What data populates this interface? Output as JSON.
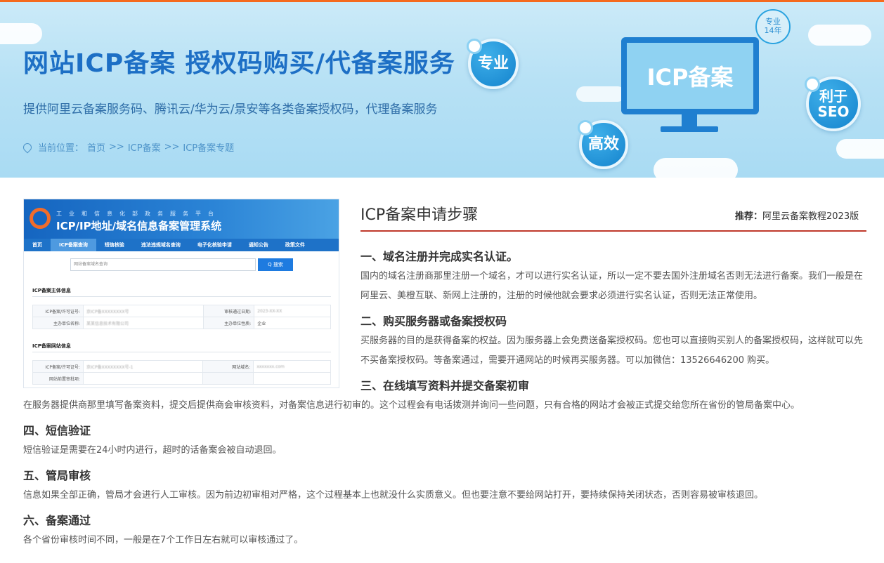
{
  "banner": {
    "title": "网站ICP备案 授权码购买/代备案服务",
    "subtitle": "提供阿里云备案服务码、腾讯云/华为云/景安等各类备案授权码，代理备案服务",
    "breadcrumb_prefix": "当前位置：",
    "breadcrumb": [
      "首页",
      "ICP备案",
      "ICP备案专题"
    ],
    "breadcrumb_sep": ">>",
    "badge_top": "专业",
    "badge_bottom": "14年",
    "bubbles": {
      "pro": "专业",
      "efficient": "高效",
      "seo_line1": "利于",
      "seo_line2": "SEO"
    },
    "monitor_text": "ICP备案"
  },
  "screenshot": {
    "top_small": "工业和信息化部政务服务平台",
    "title": "ICP/IP地址/域名信息备案管理系统",
    "nav": [
      "首页",
      "ICP备案查询",
      "短信核验",
      "违法违规域名查询",
      "电子化核验申请",
      "通知公告",
      "政策文件"
    ],
    "search_placeholder": "网站备案域名查询",
    "search_button": "Q 搜索",
    "section1": "ICP备案主体信息",
    "section2": "ICP备案网站信息",
    "rows1": [
      {
        "k1": "ICP备案/许可证号:",
        "v1": "京ICP备XXXXXXXX号",
        "k2": "审核通过日期:",
        "v2": "2023-XX-XX"
      },
      {
        "k1": "主办单位名称:",
        "v1": "某某信息技术有限公司",
        "k2": "主办单位性质:",
        "v2": "企业"
      }
    ],
    "rows2": [
      {
        "k1": "ICP备案/许可证号:",
        "v1": "京ICP备XXXXXXXX号-1",
        "k2": "网站域名:",
        "v2": "xxxxxxx.com"
      },
      {
        "k1": "网站前置审批项:",
        "v1": "",
        "k2": "",
        "v2": ""
      }
    ]
  },
  "content": {
    "title": "ICP备案申请步骤",
    "recommend_label": "推荐：",
    "recommend_link": "阿里云备案教程2023版",
    "steps": [
      {
        "heading": "一、域名注册并完成实名认证。",
        "body": "国内的域名注册商那里注册一个域名，才可以进行实名认证，所以一定不要去国外注册域名否则无法进行备案。我们一般是在阿里云、美橙互联、新网上注册的，注册的时候他就会要求必须进行实名认证，否则无法正常使用。"
      },
      {
        "heading": "二、购买服务器或备案授权码",
        "body": "买服务器的目的是获得备案的权益。因为服务器上会免费送备案授权码。您也可以直接购买别人的备案授权码，这样就可以先不买备案授权码。等备案通过，需要开通网站的时候再买服务器。可以加微信：13526646200 购买。"
      },
      {
        "heading": "三、在线填写资料并提交备案初审",
        "body": "在服务器提供商那里填写备案资料，提交后提供商会审核资料，对备案信息进行初审的。这个过程会有电话拨测并询问一些问题，只有合格的网站才会被正式提交给您所在省份的管局备案中心。"
      },
      {
        "heading": "四、短信验证",
        "body": "短信验证是需要在24小时内进行，超时的话备案会被自动退回。"
      },
      {
        "heading": "五、管局审核",
        "body": "信息如果全部正确，管局才会进行人工审核。因为前边初审相对严格，这个过程基本上也就没什么实质意义。但也要注意不要给网站打开，要持续保持关闭状态，否则容易被审核退回。"
      },
      {
        "heading": "六、备案通过",
        "body": "各个省份审核时间不同，一般是在7个工作日左右就可以审核通过了。"
      }
    ]
  },
  "colors": {
    "accent_orange": "#f56a1e",
    "title_blue": "#1d6fc5",
    "divider_red": "#c0392b",
    "banner_bg": "#b7e1f5"
  }
}
